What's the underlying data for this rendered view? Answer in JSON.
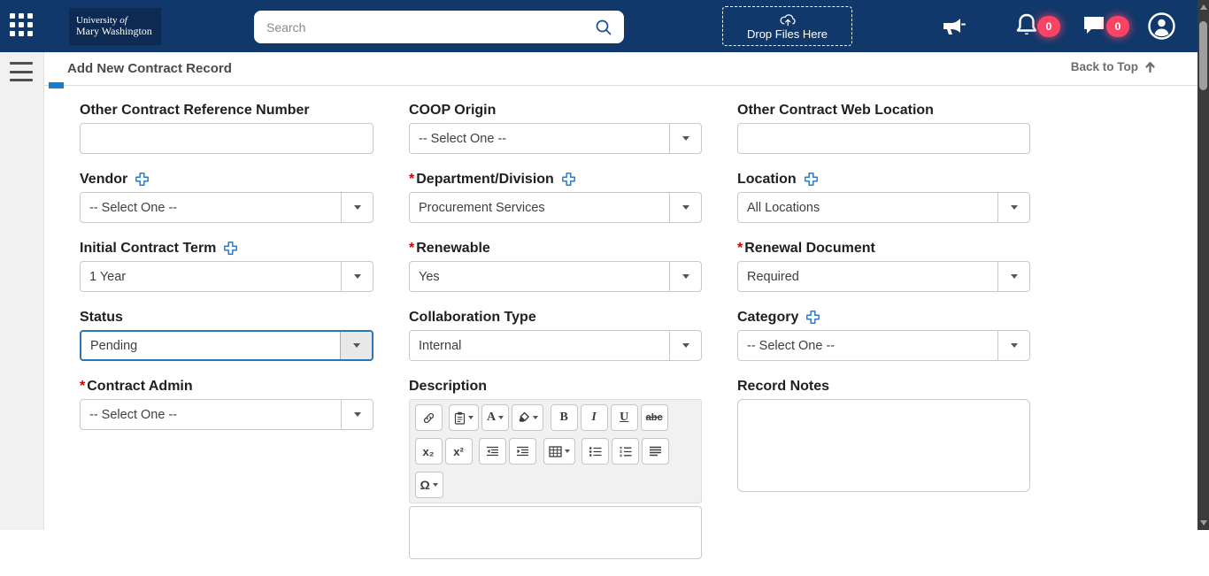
{
  "colors": {
    "topbar_bg": "#11386a",
    "logo_tile_bg": "#0c2a52",
    "badge_pink": "#fb4365",
    "accent_blue": "#1b7bd0",
    "focus_border_blue": "#2e74b5",
    "required_red": "#cc0000",
    "add_icon_blue": "#3079c5"
  },
  "icons": {
    "apps": "waffle-grid",
    "search": "magnifier",
    "upload": "cloud-upload-arrow",
    "announcements": "megaphone",
    "notifications": "bell",
    "messages": "chat-bubble",
    "account": "user-circle",
    "menu": "hamburger",
    "back_to_top": "arrow-up",
    "add_field": "plus-outline",
    "dropdown": "caret-down"
  },
  "topbar": {
    "logo": {
      "line1_a": "University",
      "line1_b": "of",
      "line2": "Mary Washington"
    },
    "search_placeholder": "Search",
    "dropzone_label": "Drop Files Here",
    "notification_count": "0",
    "message_count": "0"
  },
  "header": {
    "title": "Add New Contract Record",
    "back_to_top_label": "Back to Top"
  },
  "form": {
    "required_marker": "*",
    "other_ref": {
      "label": "Other Contract Reference Number",
      "value": ""
    },
    "coop_origin": {
      "label": "COOP Origin",
      "value": "-- Select One --"
    },
    "other_web": {
      "label": "Other Contract Web Location",
      "value": ""
    },
    "vendor": {
      "label": "Vendor",
      "value": "-- Select One --"
    },
    "department": {
      "label": "Department/Division",
      "value": "Procurement Services",
      "required": true
    },
    "location": {
      "label": "Location",
      "value": "All Locations"
    },
    "initial_term": {
      "label": "Initial Contract Term",
      "value": "1 Year"
    },
    "renewable": {
      "label": "Renewable",
      "value": "Yes",
      "required": true
    },
    "renewal_document": {
      "label": "Renewal Document",
      "value": "Required",
      "required": true
    },
    "status": {
      "label": "Status",
      "value": "Pending",
      "focused": true
    },
    "collaboration_type": {
      "label": "Collaboration Type",
      "value": "Internal"
    },
    "category": {
      "label": "Category",
      "value": "-- Select One --"
    },
    "contract_admin": {
      "label": "Contract Admin",
      "value": "-- Select One --",
      "required": true
    },
    "description": {
      "label": "Description"
    },
    "record_notes": {
      "label": "Record Notes",
      "value": ""
    }
  },
  "editor": {
    "glyphs": {
      "bold": "B",
      "italic": "I",
      "underline": "U",
      "strike": "abc",
      "subscript": "x₂",
      "superscript": "x²",
      "font": "A",
      "omega": "Ω"
    }
  }
}
